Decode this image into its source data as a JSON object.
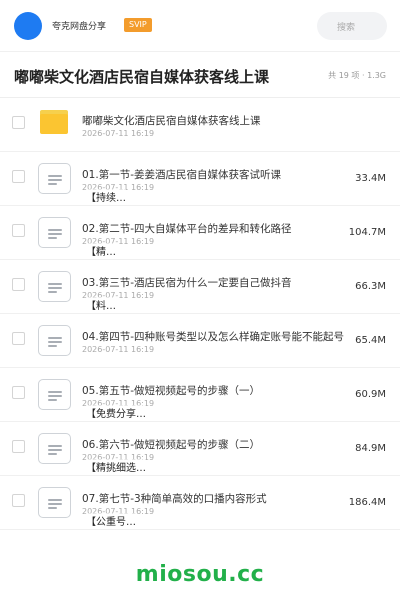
{
  "header": {
    "user_name": "夸克网盘分享",
    "badge": "SVIP",
    "search_placeholder": "搜索"
  },
  "title": {
    "text": "嘟嘟柴文化酒店民宿自媒体获客线上课",
    "meta": "共 19 项 · 1.3G"
  },
  "files": [
    {
      "type": "folder",
      "name": "嘟嘟柴文化酒店民宿自媒体获客线上课",
      "date": "2026-07-11 16:19",
      "size": "",
      "tag": ""
    },
    {
      "type": "file",
      "name": "01.第一节-姜姜酒店民宿自媒体获客试听课",
      "date": "2026-07-11 16:19",
      "size": "33.4M",
      "tag": "【持续…"
    },
    {
      "type": "file",
      "name": "02.第二节-四大自媒体平台的差异和转化路径",
      "date": "2026-07-11 16:19",
      "size": "104.7M",
      "tag": "【精…"
    },
    {
      "type": "file",
      "name": "03.第三节-酒店民宿为什么一定要自己做抖音",
      "date": "2026-07-11 16:19",
      "size": "66.3M",
      "tag": "【料…"
    },
    {
      "type": "file",
      "name": "04.第四节-四种账号类型以及怎么样确定账号能不能起号",
      "date": "2026-07-11 16:19",
      "size": "65.4M",
      "tag": ""
    },
    {
      "type": "file",
      "name": "05.第五节-做短视频起号的步骤（一）",
      "date": "2026-07-11 16:19",
      "size": "60.9M",
      "tag": "【免费分享…"
    },
    {
      "type": "file",
      "name": "06.第六节-做短视频起号的步骤（二）",
      "date": "2026-07-11 16:19",
      "size": "84.9M",
      "tag": "【精挑细选…"
    },
    {
      "type": "file",
      "name": "07.第七节-3种简单高效的口播内容形式",
      "date": "2026-07-11 16:19",
      "size": "186.4M",
      "tag": "【公重号…"
    }
  ],
  "watermark": "miosou.cc",
  "colors": {
    "accent": "#1e7bf2",
    "badge": "#f39c2c",
    "folder": "#fbc531",
    "watermark": "#22b04a"
  },
  "icons": {
    "folder": "folder-icon",
    "file": "document-icon"
  }
}
